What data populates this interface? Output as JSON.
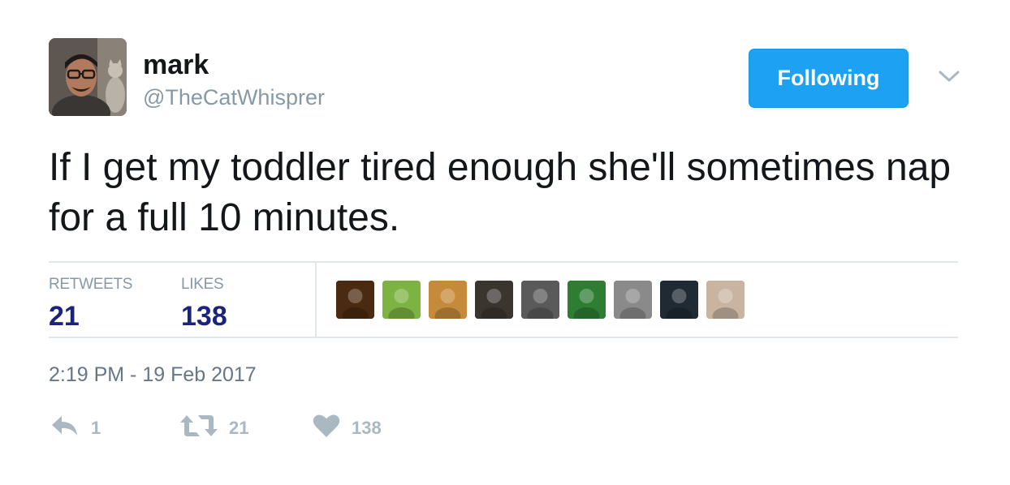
{
  "author": {
    "display_name": "mark",
    "handle": "@TheCatWhisprer"
  },
  "follow_button": {
    "label": "Following",
    "color": "#1da1f2"
  },
  "more_menu_icon": "chevron-down-icon",
  "tweet": {
    "text": "If I get my toddler tired enough she'll sometimes nap for a full 10 minutes."
  },
  "stats": {
    "retweets_label": "RETWEETS",
    "retweets_count": "21",
    "likes_label": "LIKES",
    "likes_count": "138"
  },
  "likers": [
    {
      "name": "liker-1",
      "color": "#4a2a10"
    },
    {
      "name": "liker-2",
      "color": "#7cb342"
    },
    {
      "name": "liker-3",
      "color": "#c58a3a"
    },
    {
      "name": "liker-4",
      "color": "#3b3530"
    },
    {
      "name": "liker-5",
      "color": "#5a5a5a"
    },
    {
      "name": "liker-6",
      "color": "#2e7d32"
    },
    {
      "name": "liker-7",
      "color": "#8a8a8a"
    },
    {
      "name": "liker-8",
      "color": "#1f2a33"
    },
    {
      "name": "liker-9",
      "color": "#c9b4a2"
    }
  ],
  "timestamp": "2:19 PM - 19 Feb 2017",
  "actions": {
    "reply_count": "1",
    "retweet_count": "21",
    "like_count": "138",
    "icon_color": "#aab8c2"
  }
}
